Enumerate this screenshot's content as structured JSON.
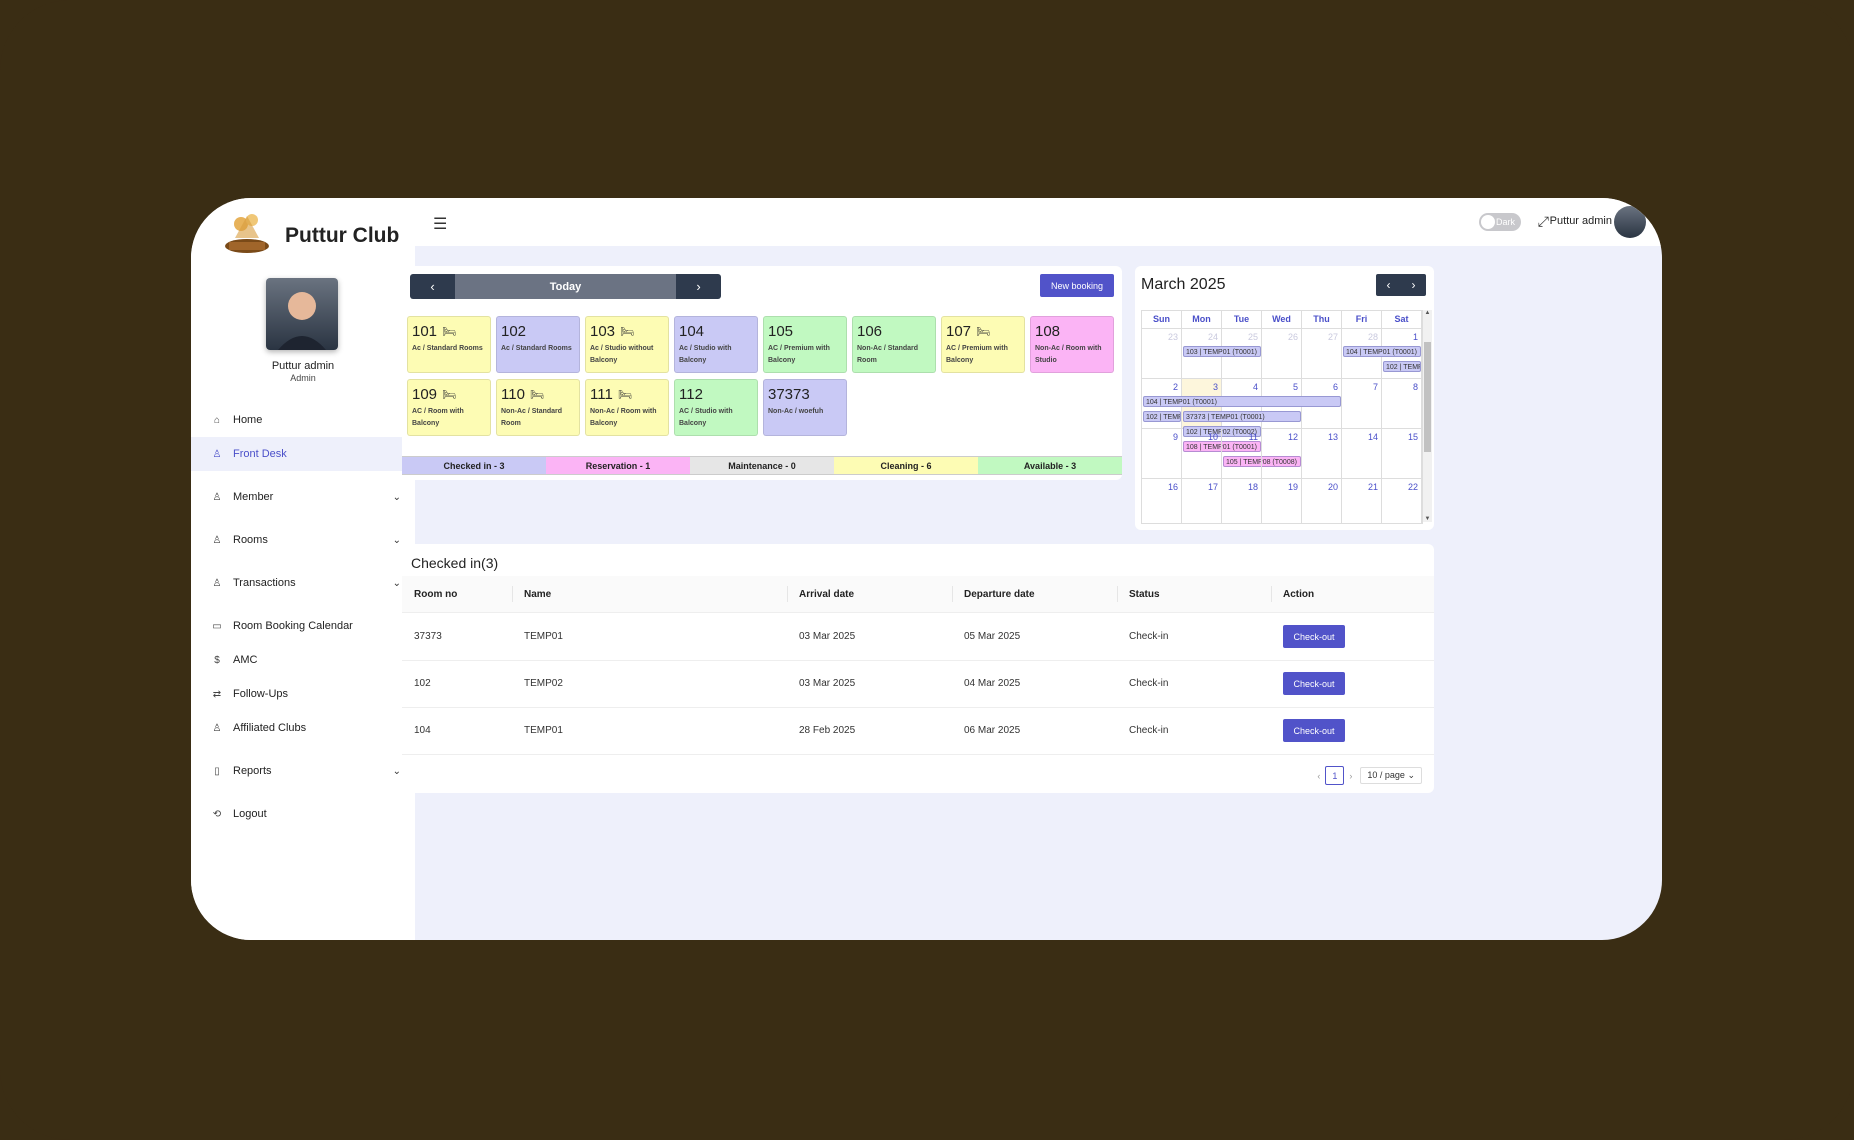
{
  "brand": {
    "title": "Puttur Club"
  },
  "profile": {
    "name": "Puttur admin",
    "role": "Admin"
  },
  "nav": [
    {
      "label": "Home",
      "icon": "home-icon",
      "glyph": "⌂"
    },
    {
      "label": "Front Desk",
      "icon": "front-desk-icon",
      "glyph": "♙",
      "active": true
    },
    {
      "label": "Member",
      "icon": "member-icon",
      "glyph": "♙",
      "chevron": true
    },
    {
      "label": "Rooms",
      "icon": "rooms-icon",
      "glyph": "♙",
      "chevron": true
    },
    {
      "label": "Transactions",
      "icon": "transactions-icon",
      "glyph": "♙",
      "chevron": true
    },
    {
      "label": "Room Booking Calendar",
      "icon": "calendar-icon",
      "glyph": "▭"
    },
    {
      "label": "AMC",
      "icon": "amc-icon",
      "glyph": "$"
    },
    {
      "label": "Follow-Ups",
      "icon": "follow-ups-icon",
      "glyph": "⇄"
    },
    {
      "label": "Affiliated Clubs",
      "icon": "clubs-icon",
      "glyph": "♙"
    },
    {
      "label": "Reports",
      "icon": "reports-icon",
      "glyph": "▯",
      "chevron": true
    },
    {
      "label": "Logout",
      "icon": "logout-icon",
      "glyph": "⟲"
    }
  ],
  "header": {
    "dark_label": "Dark",
    "user_name": "Puttur admin"
  },
  "frontdesk": {
    "today_label": "Today",
    "new_booking_label": "New booking"
  },
  "rooms": [
    {
      "num": "101",
      "type": "Ac / Standard Rooms",
      "status": "cleaning",
      "bed": true
    },
    {
      "num": "102",
      "type": "Ac / Standard Rooms",
      "status": "checkedin",
      "bed": false
    },
    {
      "num": "103",
      "type": "Ac / Studio without Balcony",
      "status": "cleaning",
      "bed": true
    },
    {
      "num": "104",
      "type": "Ac / Studio with Balcony",
      "status": "checkedin",
      "bed": false
    },
    {
      "num": "105",
      "type": "AC / Premium with Balcony",
      "status": "available",
      "bed": false
    },
    {
      "num": "106",
      "type": "Non-Ac / Standard Room",
      "status": "available",
      "bed": false
    },
    {
      "num": "107",
      "type": "AC / Premium with Balcony",
      "status": "cleaning",
      "bed": true
    },
    {
      "num": "108",
      "type": "Non-Ac / Room with Studio",
      "status": "reservation",
      "bed": false
    },
    {
      "num": "109",
      "type": "AC / Room with Balcony",
      "status": "cleaning",
      "bed": true
    },
    {
      "num": "110",
      "type": "Non-Ac / Standard Room",
      "status": "cleaning",
      "bed": true
    },
    {
      "num": "111",
      "type": "Non-Ac / Room with Balcony",
      "status": "cleaning",
      "bed": true
    },
    {
      "num": "112",
      "type": "AC / Studio with Balcony",
      "status": "available",
      "bed": false
    },
    {
      "num": "37373",
      "type": "Non-Ac / woefuh",
      "status": "checkedin",
      "bed": false
    }
  ],
  "status_colors": {
    "checkedin": "#c9c9f5",
    "reservation": "#fbb4f5",
    "maintenance": "#e6e6e6",
    "cleaning": "#fdfcb4",
    "available": "#c1f9c1"
  },
  "legend": [
    {
      "label": "Checked in - 3",
      "status": "checkedin"
    },
    {
      "label": "Reservation - 1",
      "status": "reservation"
    },
    {
      "label": "Maintenance - 0",
      "status": "maintenance"
    },
    {
      "label": "Cleaning - 6",
      "status": "cleaning"
    },
    {
      "label": "Available - 3",
      "status": "available"
    }
  ],
  "calendar": {
    "title": "March 2025",
    "weekdays": [
      "Sun",
      "Mon",
      "Tue",
      "Wed",
      "Thu",
      "Fri",
      "Sat"
    ],
    "weeks": [
      {
        "days": [
          "23",
          "24",
          "25",
          "26",
          "27",
          "28",
          "1"
        ],
        "muted": [
          0,
          1,
          2,
          3,
          4,
          5
        ]
      },
      {
        "days": [
          "2",
          "3",
          "4",
          "5",
          "6",
          "7",
          "8"
        ],
        "today": 1
      },
      {
        "days": [
          "9",
          "10",
          "11",
          "12",
          "13",
          "14",
          "15"
        ]
      },
      {
        "days": [
          "16",
          "17",
          "18",
          "19",
          "20",
          "21",
          "22"
        ]
      }
    ],
    "events": [
      {
        "label": "103 | TEMP01 (T0001)",
        "week": 0,
        "start": 1,
        "span": 2,
        "line": 0,
        "status": "checkedin"
      },
      {
        "label": "104 | TEMP01 (T0001)",
        "week": 0,
        "start": 5,
        "span": 2,
        "line": 0,
        "status": "checkedin"
      },
      {
        "label": "102 | TEMP02 (T0002)",
        "week": 0,
        "start": 6,
        "span": 1,
        "line": 1,
        "status": "checkedin"
      },
      {
        "label": "104 | TEMP01 (T0001)",
        "week": 1,
        "start": 0,
        "span": 5,
        "line": 0,
        "status": "checkedin"
      },
      {
        "label": "102 | TEMP01 (T0001)",
        "week": 1,
        "start": 0,
        "span": 1,
        "line": 1,
        "status": "checkedin"
      },
      {
        "label": "37373 | TEMP01 (T0001)",
        "week": 1,
        "start": 1,
        "span": 3,
        "line": 1,
        "status": "checkedin"
      },
      {
        "label": "102 | TEMP02 (T0002)",
        "week": 1,
        "start": 1,
        "span": 2,
        "line": 2,
        "status": "checkedin"
      },
      {
        "label": "108 | TEMP01 (T0001)",
        "week": 1,
        "start": 1,
        "span": 2,
        "line": 3,
        "status": "reservation"
      },
      {
        "label": "105 | TEMP08 (T0008)",
        "week": 1,
        "start": 2,
        "span": 2,
        "line": 4,
        "status": "reservation"
      }
    ]
  },
  "checked_in": {
    "title": "Checked in(3)",
    "columns": [
      "Room no",
      "Name",
      "Arrival date",
      "Departure date",
      "Status",
      "Action"
    ],
    "rows": [
      {
        "room": "37373",
        "name": "TEMP01",
        "arrival": "03 Mar 2025",
        "departure": "05 Mar 2025",
        "status": "Check-in",
        "action": "Check-out"
      },
      {
        "room": "102",
        "name": "TEMP02",
        "arrival": "03 Mar 2025",
        "departure": "04 Mar 2025",
        "status": "Check-in",
        "action": "Check-out"
      },
      {
        "room": "104",
        "name": "TEMP01",
        "arrival": "28 Feb 2025",
        "departure": "06 Mar 2025",
        "status": "Check-in",
        "action": "Check-out"
      }
    ],
    "pagination": {
      "current_page": "1",
      "page_size": "10 / page"
    }
  }
}
